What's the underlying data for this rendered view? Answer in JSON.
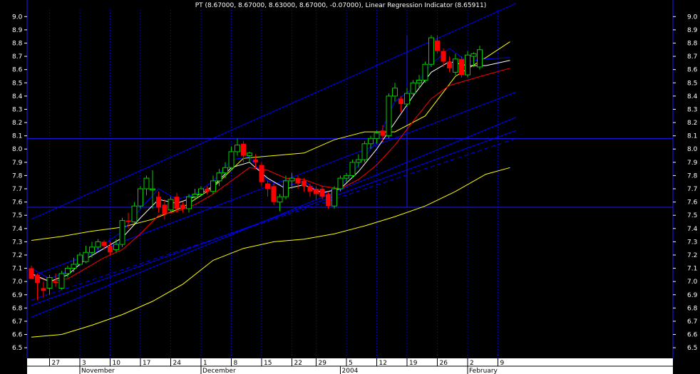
{
  "chart_data": {
    "type": "candlestick",
    "title": "PT (8.67000, 8.67000, 8.63000, 8.67000, -0.07000), Linear Regression Indicator (8.65911)",
    "y_ticks": [
      "9.0",
      "8.9",
      "8.8",
      "8.7",
      "8.6",
      "8.5",
      "8.4",
      "8.3",
      "8.2",
      "8.1",
      "8.0",
      "7.9",
      "7.8",
      "7.7",
      "7.6",
      "7.5",
      "7.4",
      "7.3",
      "7.2",
      "7.1",
      "7.0",
      "6.9",
      "6.8",
      "6.7",
      "6.6",
      "6.5"
    ],
    "ylim": [
      6.42,
      9.05
    ],
    "x_ticks": [
      "27",
      "3",
      "10",
      "17",
      "24",
      "1",
      "8",
      "15",
      "22",
      "29",
      "5",
      "12",
      "19",
      "26",
      "2",
      "9"
    ],
    "x_tick_slots": [
      3,
      8,
      13,
      18,
      23,
      28,
      33,
      38,
      43,
      47,
      52,
      57,
      62,
      67,
      72,
      77
    ],
    "months": [
      "November",
      "December",
      "2004",
      "February"
    ],
    "month_slots": [
      8,
      28,
      51,
      72
    ],
    "horizontal_levels": [
      8.08,
      7.56
    ],
    "vertical_marker_slot": 62,
    "colors": {
      "background": "#000000",
      "grid": "#1a1aff",
      "up": "#00cc00",
      "down": "#ff0000",
      "regression": "#0000ff",
      "envelope": "#ffff00",
      "ma_fast": "#ffffff",
      "ma_slow": "#ff0000",
      "axis_panel": "#ffffff"
    },
    "candles": [
      {
        "o": 7.1,
        "h": 7.12,
        "l": 7.02,
        "c": 7.02
      },
      {
        "o": 7.05,
        "h": 7.06,
        "l": 6.86,
        "c": 6.99
      },
      {
        "o": 6.95,
        "h": 7.0,
        "l": 6.88,
        "c": 6.93
      },
      {
        "o": 6.95,
        "h": 7.05,
        "l": 6.9,
        "c": 7.03
      },
      {
        "o": 7.0,
        "h": 7.06,
        "l": 6.96,
        "c": 6.99
      },
      {
        "o": 6.95,
        "h": 7.08,
        "l": 6.94,
        "c": 7.06
      },
      {
        "o": 7.06,
        "h": 7.12,
        "l": 7.03,
        "c": 7.1
      },
      {
        "o": 7.1,
        "h": 7.18,
        "l": 7.07,
        "c": 7.13
      },
      {
        "o": 7.13,
        "h": 7.22,
        "l": 7.12,
        "c": 7.2
      },
      {
        "o": 7.15,
        "h": 7.27,
        "l": 7.14,
        "c": 7.22
      },
      {
        "o": 7.22,
        "h": 7.3,
        "l": 7.18,
        "c": 7.26
      },
      {
        "o": 7.26,
        "h": 7.32,
        "l": 7.24,
        "c": 7.3
      },
      {
        "o": 7.3,
        "h": 7.31,
        "l": 7.24,
        "c": 7.27
      },
      {
        "o": 7.27,
        "h": 7.3,
        "l": 7.2,
        "c": 7.22
      },
      {
        "o": 7.24,
        "h": 7.32,
        "l": 7.22,
        "c": 7.28
      },
      {
        "o": 7.28,
        "h": 7.48,
        "l": 7.26,
        "c": 7.46
      },
      {
        "o": 7.46,
        "h": 7.52,
        "l": 7.4,
        "c": 7.45
      },
      {
        "o": 7.45,
        "h": 7.6,
        "l": 7.44,
        "c": 7.57
      },
      {
        "o": 7.57,
        "h": 7.72,
        "l": 7.55,
        "c": 7.7
      },
      {
        "o": 7.7,
        "h": 7.8,
        "l": 7.65,
        "c": 7.78
      },
      {
        "o": 7.7,
        "h": 7.84,
        "l": 7.55,
        "c": 7.7
      },
      {
        "o": 7.64,
        "h": 7.68,
        "l": 7.52,
        "c": 7.56
      },
      {
        "o": 7.58,
        "h": 7.62,
        "l": 7.47,
        "c": 7.51
      },
      {
        "o": 7.54,
        "h": 7.64,
        "l": 7.52,
        "c": 7.62
      },
      {
        "o": 7.64,
        "h": 7.67,
        "l": 7.52,
        "c": 7.55
      },
      {
        "o": 7.58,
        "h": 7.6,
        "l": 7.52,
        "c": 7.55
      },
      {
        "o": 7.55,
        "h": 7.66,
        "l": 7.52,
        "c": 7.64
      },
      {
        "o": 7.64,
        "h": 7.7,
        "l": 7.62,
        "c": 7.66
      },
      {
        "o": 7.66,
        "h": 7.72,
        "l": 7.64,
        "c": 7.7
      },
      {
        "o": 7.7,
        "h": 7.72,
        "l": 7.66,
        "c": 7.68
      },
      {
        "o": 7.68,
        "h": 7.8,
        "l": 7.66,
        "c": 7.76
      },
      {
        "o": 7.76,
        "h": 7.85,
        "l": 7.72,
        "c": 7.82
      },
      {
        "o": 7.82,
        "h": 7.9,
        "l": 7.78,
        "c": 7.86
      },
      {
        "o": 7.86,
        "h": 8.02,
        "l": 7.84,
        "c": 7.98
      },
      {
        "o": 7.98,
        "h": 8.08,
        "l": 7.95,
        "c": 8.03
      },
      {
        "o": 8.04,
        "h": 8.06,
        "l": 7.9,
        "c": 7.95
      },
      {
        "o": 7.95,
        "h": 7.98,
        "l": 7.9,
        "c": 7.97
      },
      {
        "o": 7.92,
        "h": 7.96,
        "l": 7.85,
        "c": 7.9
      },
      {
        "o": 7.88,
        "h": 7.9,
        "l": 7.72,
        "c": 7.75
      },
      {
        "o": 7.74,
        "h": 7.76,
        "l": 7.64,
        "c": 7.7
      },
      {
        "o": 7.72,
        "h": 7.74,
        "l": 7.58,
        "c": 7.6
      },
      {
        "o": 7.6,
        "h": 7.66,
        "l": 7.53,
        "c": 7.64
      },
      {
        "o": 7.64,
        "h": 7.8,
        "l": 7.62,
        "c": 7.76
      },
      {
        "o": 7.76,
        "h": 7.82,
        "l": 7.7,
        "c": 7.78
      },
      {
        "o": 7.78,
        "h": 7.8,
        "l": 7.7,
        "c": 7.74
      },
      {
        "o": 7.76,
        "h": 7.78,
        "l": 7.68,
        "c": 7.72
      },
      {
        "o": 7.72,
        "h": 7.74,
        "l": 7.64,
        "c": 7.68
      },
      {
        "o": 7.7,
        "h": 7.72,
        "l": 7.62,
        "c": 7.66
      },
      {
        "o": 7.7,
        "h": 7.72,
        "l": 7.62,
        "c": 7.64
      },
      {
        "o": 7.66,
        "h": 7.68,
        "l": 7.55,
        "c": 7.57
      },
      {
        "o": 7.57,
        "h": 7.72,
        "l": 7.55,
        "c": 7.7
      },
      {
        "o": 7.7,
        "h": 7.8,
        "l": 7.68,
        "c": 7.78
      },
      {
        "o": 7.78,
        "h": 7.82,
        "l": 7.75,
        "c": 7.8
      },
      {
        "o": 7.8,
        "h": 7.92,
        "l": 7.78,
        "c": 7.9
      },
      {
        "o": 7.9,
        "h": 7.96,
        "l": 7.86,
        "c": 7.92
      },
      {
        "o": 7.92,
        "h": 8.06,
        "l": 7.9,
        "c": 8.04
      },
      {
        "o": 8.04,
        "h": 8.1,
        "l": 8.0,
        "c": 8.08
      },
      {
        "o": 8.08,
        "h": 8.14,
        "l": 8.04,
        "c": 8.12
      },
      {
        "o": 8.14,
        "h": 8.18,
        "l": 8.05,
        "c": 8.1
      },
      {
        "o": 8.1,
        "h": 8.42,
        "l": 8.08,
        "c": 8.4
      },
      {
        "o": 8.4,
        "h": 8.5,
        "l": 8.36,
        "c": 8.46
      },
      {
        "o": 8.38,
        "h": 8.4,
        "l": 8.28,
        "c": 8.34
      },
      {
        "o": 8.34,
        "h": 8.46,
        "l": 8.32,
        "c": 8.42
      },
      {
        "o": 8.42,
        "h": 8.52,
        "l": 8.4,
        "c": 8.5
      },
      {
        "o": 8.5,
        "h": 8.56,
        "l": 8.46,
        "c": 8.52
      },
      {
        "o": 8.52,
        "h": 8.66,
        "l": 8.5,
        "c": 8.64
      },
      {
        "o": 8.64,
        "h": 8.86,
        "l": 8.62,
        "c": 8.84
      },
      {
        "o": 8.82,
        "h": 8.86,
        "l": 8.72,
        "c": 8.74
      },
      {
        "o": 8.74,
        "h": 8.76,
        "l": 8.62,
        "c": 8.66
      },
      {
        "o": 8.66,
        "h": 8.7,
        "l": 8.58,
        "c": 8.61
      },
      {
        "o": 8.58,
        "h": 8.72,
        "l": 8.56,
        "c": 8.68
      },
      {
        "o": 8.68,
        "h": 8.7,
        "l": 8.54,
        "c": 8.56
      },
      {
        "o": 8.56,
        "h": 8.74,
        "l": 8.54,
        "c": 8.71
      },
      {
        "o": 8.7,
        "h": 8.73,
        "l": 8.62,
        "c": 8.72
      },
      {
        "o": 8.62,
        "h": 8.78,
        "l": 8.6,
        "c": 8.75
      }
    ],
    "linear_regression_channel": {
      "start_slot": 0,
      "end_slot": 80,
      "center": [
        7.04,
        8.43
      ],
      "upper": [
        7.47,
        9.1
      ],
      "lower_1": [
        6.73,
        8.24
      ],
      "lower_2": [
        6.82,
        8.14
      ],
      "dashed": [
        6.86,
        8.08
      ]
    },
    "envelope_upper": [
      [
        0,
        7.31
      ],
      [
        5,
        7.34
      ],
      [
        10,
        7.38
      ],
      [
        15,
        7.41
      ],
      [
        20,
        7.47
      ],
      [
        25,
        7.56
      ],
      [
        30,
        7.71
      ],
      [
        35,
        7.93
      ],
      [
        40,
        7.95
      ],
      [
        45,
        7.97
      ],
      [
        50,
        8.07
      ],
      [
        55,
        8.13
      ],
      [
        60,
        8.13
      ],
      [
        65,
        8.25
      ],
      [
        70,
        8.55
      ],
      [
        75,
        8.69
      ],
      [
        79,
        8.81
      ]
    ],
    "envelope_lower": [
      [
        0,
        6.58
      ],
      [
        5,
        6.6
      ],
      [
        10,
        6.67
      ],
      [
        15,
        6.75
      ],
      [
        20,
        6.85
      ],
      [
        25,
        6.98
      ],
      [
        30,
        7.16
      ],
      [
        35,
        7.25
      ],
      [
        40,
        7.3
      ],
      [
        45,
        7.32
      ],
      [
        50,
        7.36
      ],
      [
        55,
        7.42
      ],
      [
        60,
        7.49
      ],
      [
        65,
        7.57
      ],
      [
        70,
        7.68
      ],
      [
        75,
        7.81
      ],
      [
        79,
        7.86
      ]
    ],
    "ma_fast": [
      [
        0,
        7.06
      ],
      [
        3,
        7.0
      ],
      [
        6,
        7.05
      ],
      [
        9,
        7.17
      ],
      [
        12,
        7.25
      ],
      [
        15,
        7.33
      ],
      [
        18,
        7.48
      ],
      [
        21,
        7.62
      ],
      [
        24,
        7.59
      ],
      [
        27,
        7.64
      ],
      [
        30,
        7.72
      ],
      [
        33,
        7.86
      ],
      [
        36,
        7.9
      ],
      [
        39,
        7.78
      ],
      [
        42,
        7.7
      ],
      [
        45,
        7.73
      ],
      [
        48,
        7.67
      ],
      [
        51,
        7.7
      ],
      [
        54,
        7.83
      ],
      [
        57,
        8.0
      ],
      [
        60,
        8.2
      ],
      [
        63,
        8.4
      ],
      [
        66,
        8.58
      ],
      [
        69,
        8.66
      ],
      [
        72,
        8.63
      ],
      [
        75,
        8.63
      ],
      [
        79,
        8.67
      ]
    ],
    "ma_slow": [
      [
        0,
        7.05
      ],
      [
        3,
        7.0
      ],
      [
        6,
        7.02
      ],
      [
        9,
        7.1
      ],
      [
        12,
        7.18
      ],
      [
        15,
        7.24
      ],
      [
        18,
        7.36
      ],
      [
        21,
        7.5
      ],
      [
        24,
        7.53
      ],
      [
        27,
        7.58
      ],
      [
        30,
        7.66
      ],
      [
        33,
        7.76
      ],
      [
        36,
        7.86
      ],
      [
        39,
        7.84
      ],
      [
        42,
        7.78
      ],
      [
        45,
        7.77
      ],
      [
        48,
        7.72
      ],
      [
        51,
        7.7
      ],
      [
        54,
        7.77
      ],
      [
        57,
        7.88
      ],
      [
        60,
        8.03
      ],
      [
        63,
        8.21
      ],
      [
        66,
        8.38
      ],
      [
        69,
        8.48
      ],
      [
        72,
        8.52
      ],
      [
        75,
        8.56
      ],
      [
        79,
        8.61
      ]
    ],
    "blue_ma": [
      [
        0,
        7.1
      ],
      [
        3,
        7.02
      ],
      [
        6,
        7.08
      ],
      [
        9,
        7.2
      ],
      [
        12,
        7.28
      ],
      [
        15,
        7.38
      ],
      [
        18,
        7.55
      ],
      [
        21,
        7.7
      ],
      [
        24,
        7.62
      ],
      [
        27,
        7.66
      ],
      [
        30,
        7.76
      ],
      [
        33,
        7.92
      ],
      [
        36,
        7.94
      ],
      [
        39,
        7.76
      ],
      [
        42,
        7.72
      ],
      [
        45,
        7.76
      ],
      [
        48,
        7.66
      ],
      [
        51,
        7.72
      ],
      [
        54,
        7.88
      ],
      [
        57,
        8.06
      ],
      [
        60,
        8.36
      ],
      [
        63,
        8.46
      ],
      [
        66,
        8.64
      ],
      [
        69,
        8.76
      ],
      [
        72,
        8.66
      ],
      [
        75,
        8.68
      ],
      [
        79,
        8.69
      ]
    ]
  }
}
